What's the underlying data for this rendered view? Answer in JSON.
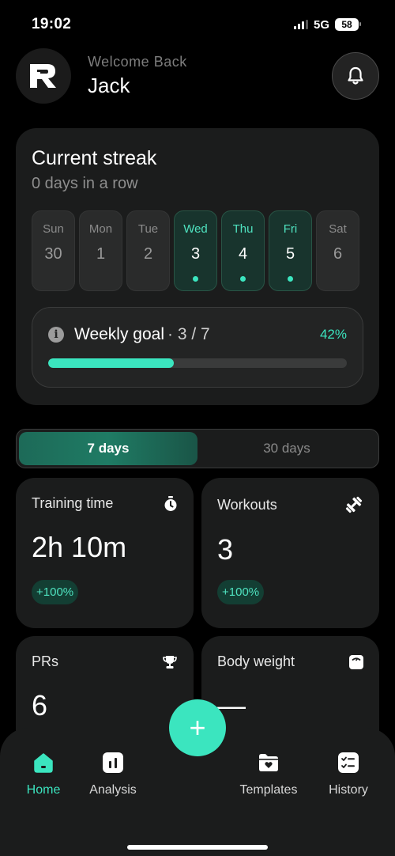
{
  "status_bar": {
    "time": "19:02",
    "network": "5G",
    "battery": "58"
  },
  "header": {
    "welcome": "Welcome Back",
    "name": "Jack"
  },
  "streak": {
    "title": "Current streak",
    "subtitle": "0 days in a row",
    "days": [
      {
        "name": "Sun",
        "num": "30",
        "active": false
      },
      {
        "name": "Mon",
        "num": "1",
        "active": false
      },
      {
        "name": "Tue",
        "num": "2",
        "active": false
      },
      {
        "name": "Wed",
        "num": "3",
        "active": true
      },
      {
        "name": "Thu",
        "num": "4",
        "active": true
      },
      {
        "name": "Fri",
        "num": "5",
        "active": true
      },
      {
        "name": "Sat",
        "num": "6",
        "active": false
      }
    ],
    "goal_label": "Weekly goal",
    "goal_count": "· 3 / 7",
    "goal_percent": "42%",
    "goal_progress": 0.42
  },
  "range_toggle": {
    "option_7": "7 days",
    "option_30": "30 days"
  },
  "stats": {
    "training": {
      "label": "Training time",
      "value": "2h 10m",
      "badge": "+100%"
    },
    "workouts": {
      "label": "Workouts",
      "value": "3",
      "badge": "+100%"
    },
    "prs": {
      "label": "PRs",
      "value": "6"
    },
    "body_weight": {
      "label": "Body weight",
      "value": "—"
    }
  },
  "fab": {
    "label": "+"
  },
  "nav": {
    "home": "Home",
    "analysis": "Analysis",
    "templates": "Templates",
    "history": "History"
  },
  "colors": {
    "accent": "#3be5bf",
    "background": "#000000",
    "card": "#1b1c1c"
  }
}
